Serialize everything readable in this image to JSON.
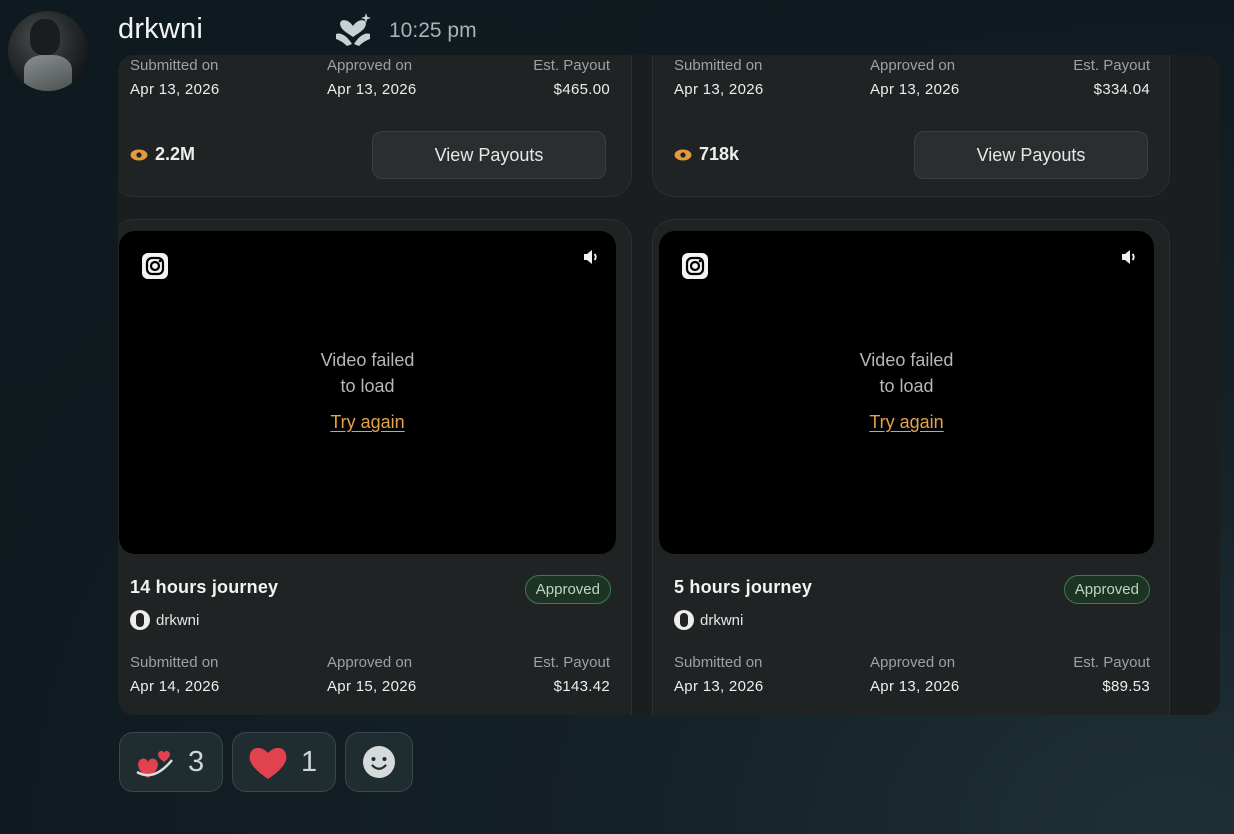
{
  "header": {
    "username": "drkwni",
    "timestamp": "10:25 pm",
    "app_icon": "heart-hands-icon"
  },
  "cards": [
    {
      "submitted_label": "Submitted on",
      "submitted_value": "Apr 13, 2026",
      "approved_label": "Approved on",
      "approved_value": "Apr 13, 2026",
      "payout_label": "Est. Payout",
      "payout_value": "$465.00",
      "views": "2.2M",
      "button_label": "View Payouts"
    },
    {
      "submitted_label": "Submitted on",
      "submitted_value": "Apr 13, 2026",
      "approved_label": "Approved on",
      "approved_value": "Apr 13, 2026",
      "payout_label": "Est. Payout",
      "payout_value": "$334.04",
      "views": "718k",
      "button_label": "View Payouts"
    },
    {
      "video_error_line1": "Video failed",
      "video_error_line2": "to load",
      "retry_label": "Try again",
      "title": "14 hours journey",
      "status": "Approved",
      "author": "drkwni",
      "submitted_label": "Submitted on",
      "submitted_value": "Apr 14, 2026",
      "approved_label": "Approved on",
      "approved_value": "Apr 15, 2026",
      "payout_label": "Est. Payout",
      "payout_value": "$143.42"
    },
    {
      "video_error_line1": "Video failed",
      "video_error_line2": "to load",
      "retry_label": "Try again",
      "title": "5 hours journey",
      "status": "Approved",
      "author": "drkwni",
      "submitted_label": "Submitted on",
      "submitted_value": "Apr 13, 2026",
      "approved_label": "Approved on",
      "approved_value": "Apr 13, 2026",
      "payout_label": "Est. Payout",
      "payout_value": "$89.53"
    }
  ],
  "reactions": [
    {
      "icon": "hearts-orbit-icon",
      "count": "3"
    },
    {
      "icon": "heart-icon",
      "count": "1"
    },
    {
      "icon": "add-reaction-icon"
    }
  ],
  "colors": {
    "accent_orange": "#e2a34a",
    "approved_green": "#3e7a53",
    "heart_red": "#e0434f"
  }
}
